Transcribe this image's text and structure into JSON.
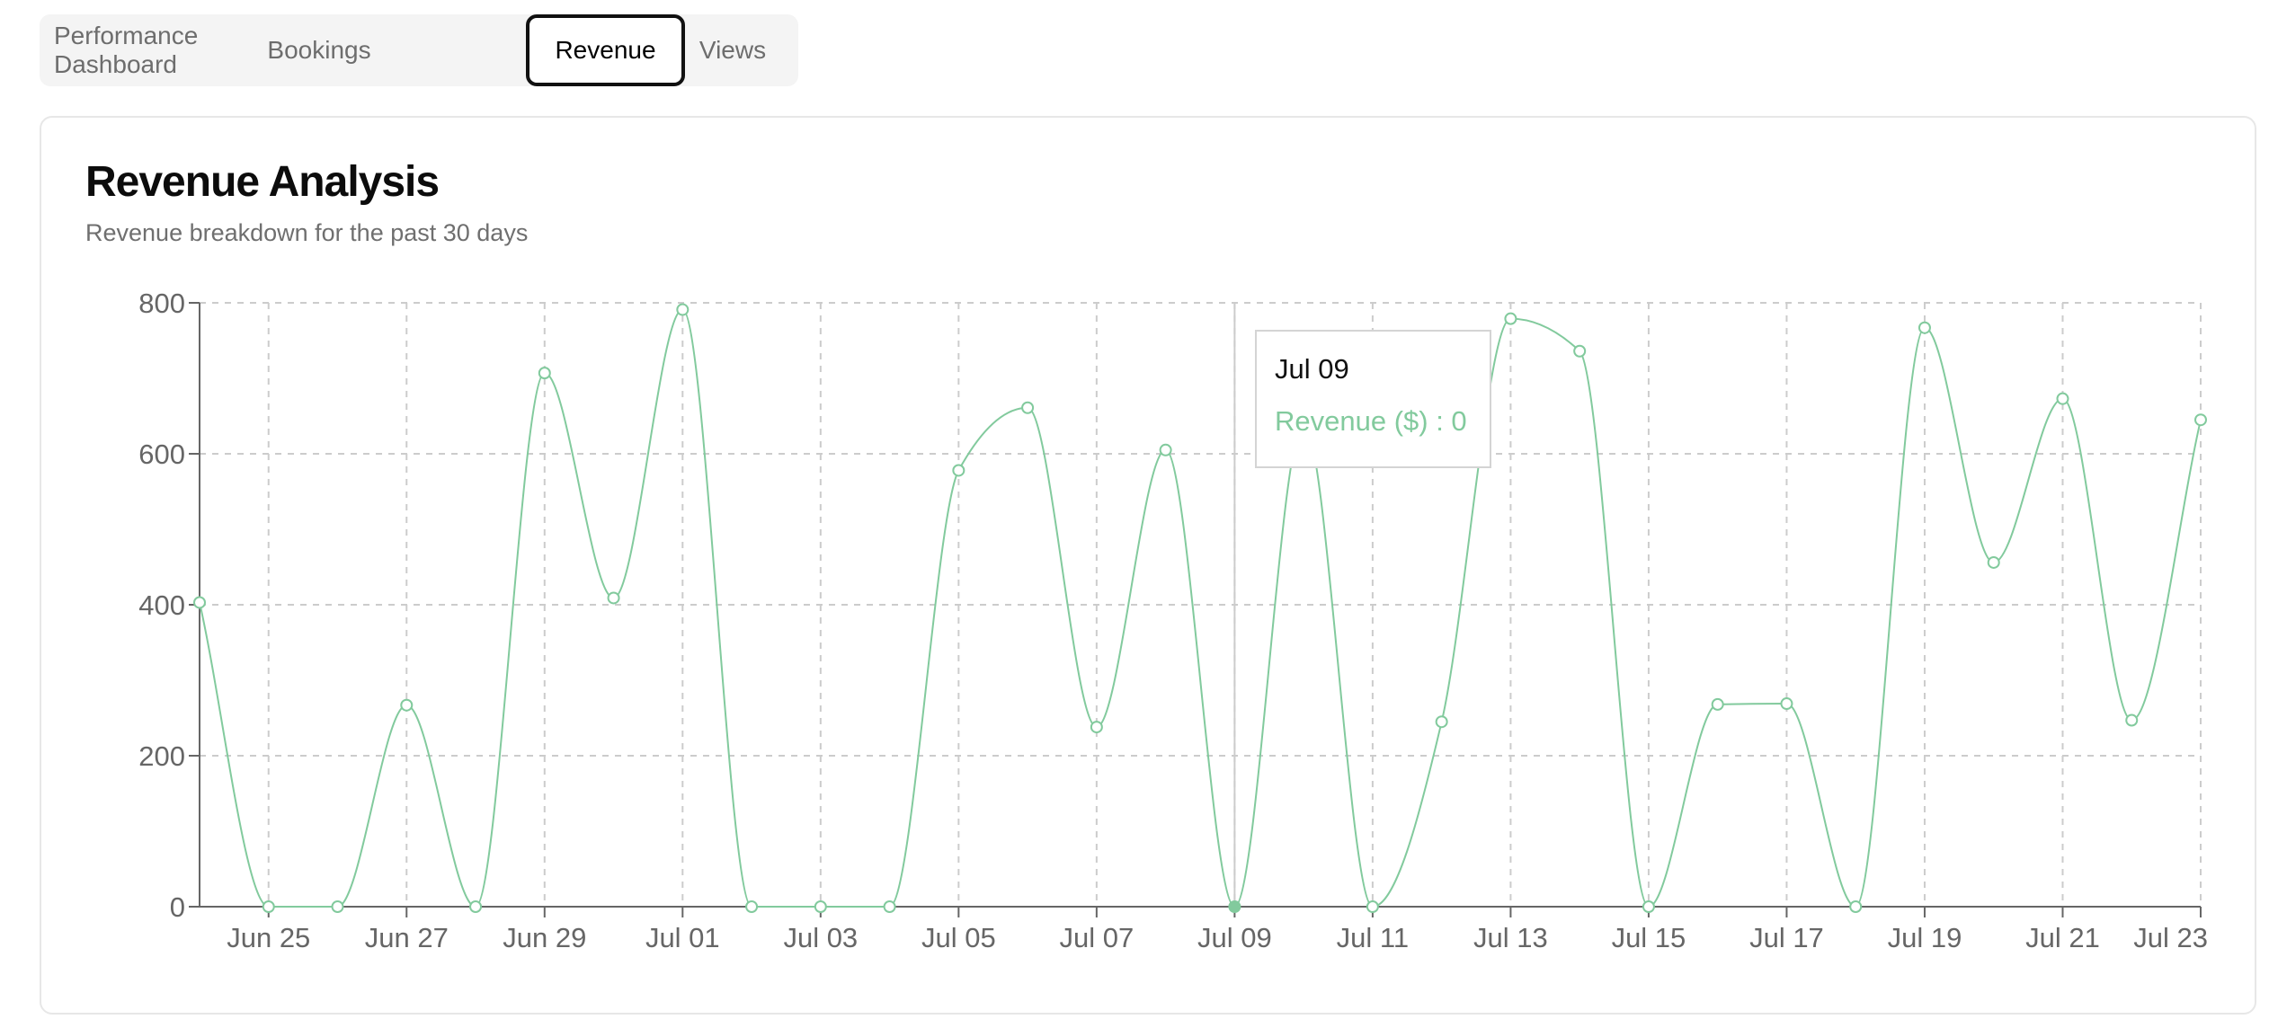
{
  "tabs": [
    {
      "label": "Performance Dashboard",
      "active": false
    },
    {
      "label": "Bookings",
      "active": false
    },
    {
      "label": "Revenue",
      "active": true
    },
    {
      "label": "Views",
      "active": false
    }
  ],
  "card": {
    "title": "Revenue Analysis",
    "subtitle": "Revenue breakdown for the past 30 days"
  },
  "tooltip": {
    "label": "Jul 09",
    "value": "Revenue ($) : 0"
  },
  "colors": {
    "series": "#82ca9d",
    "grid": "#cccccc",
    "axis": "#666666"
  },
  "chart_data": {
    "type": "line",
    "title": "",
    "xlabel": "",
    "ylabel": "",
    "ylim": [
      0,
      800
    ],
    "yticks": [
      0,
      200,
      400,
      600,
      800
    ],
    "x": [
      "Jun 24",
      "Jun 25",
      "Jun 26",
      "Jun 27",
      "Jun 28",
      "Jun 29",
      "Jun 30",
      "Jul 01",
      "Jul 02",
      "Jul 03",
      "Jul 04",
      "Jul 05",
      "Jul 06",
      "Jul 07",
      "Jul 08",
      "Jul 09",
      "Jul 10",
      "Jul 11",
      "Jul 12",
      "Jul 13",
      "Jul 14",
      "Jul 15",
      "Jul 16",
      "Jul 17",
      "Jul 18",
      "Jul 19",
      "Jul 20",
      "Jul 21",
      "Jul 22",
      "Jul 23"
    ],
    "xtick_labels": [
      "Jun 25",
      "Jun 27",
      "Jun 29",
      "Jul 01",
      "Jul 03",
      "Jul 05",
      "Jul 07",
      "Jul 09",
      "Jul 11",
      "Jul 13",
      "Jul 15",
      "Jul 17",
      "Jul 19",
      "Jul 21",
      "Jul 23"
    ],
    "series": [
      {
        "name": "Revenue ($)",
        "values": [
          403,
          0,
          0,
          267,
          0,
          707,
          409,
          791,
          0,
          0,
          0,
          578,
          661,
          238,
          605,
          0,
          640,
          0,
          245,
          779,
          736,
          0,
          268,
          269,
          0,
          767,
          456,
          673,
          247,
          645
        ]
      }
    ],
    "active_point": "Jul 09",
    "grid": true,
    "grid_style": "dashed"
  }
}
